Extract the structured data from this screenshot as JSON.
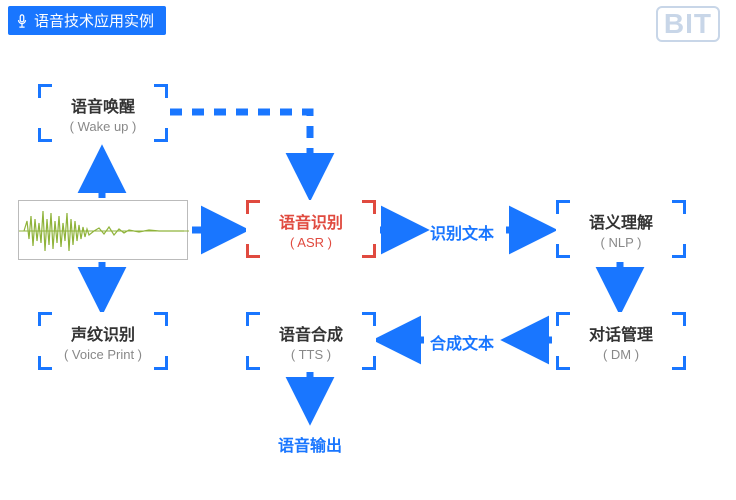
{
  "header": {
    "title": "语音技术应用实例",
    "logo": "BIT"
  },
  "nodes": {
    "wakeup": {
      "cn": "语音唤醒",
      "en": "( Wake up )"
    },
    "asr": {
      "cn": "语音识别",
      "en": "( ASR )"
    },
    "nlp": {
      "cn": "语义理解",
      "en": "( NLP )"
    },
    "voiceprint": {
      "cn": "声纹识别",
      "en": "( Voice Print )"
    },
    "tts": {
      "cn": "语音合成",
      "en": "( TTS )"
    },
    "dm": {
      "cn": "对话管理",
      "en": "( DM )"
    }
  },
  "labels": {
    "recognize_text": "识别文本",
    "synth_text": "合成文本",
    "voice_output": "语音输出"
  },
  "colors": {
    "primary": "#1976ff",
    "accent": "#e04a3f",
    "wave": "#8fb33a"
  }
}
